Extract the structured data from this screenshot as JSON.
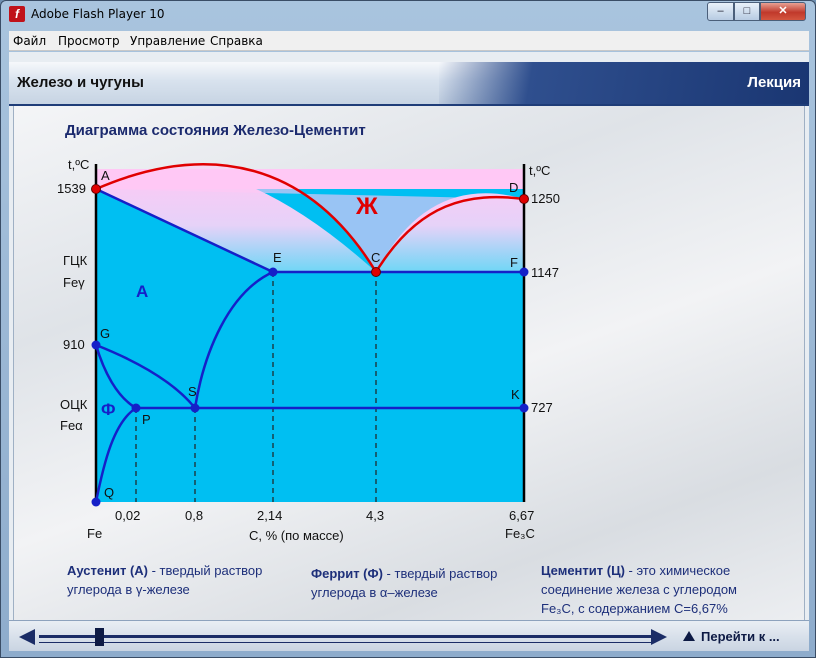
{
  "window": {
    "title": "Adobe Flash Player 10",
    "app_icon": "flash-icon"
  },
  "menu": [
    "Файл",
    "Просмотр",
    "Управление",
    "Справка"
  ],
  "header": {
    "title": "Железо и чугуны",
    "right": "Лекция"
  },
  "diagram": {
    "title": "Диаграмма состояния Железо-Цементит",
    "y_label_left": "t,ºC",
    "y_label_right": "t,ºC",
    "y_left_ticks": [
      "1539",
      "910"
    ],
    "y_right_ticks": [
      "1250",
      "1147",
      "727"
    ],
    "phase_left_gcc": [
      "ГЦК",
      "Feγ"
    ],
    "phase_left_bcc": [
      "ОЦК",
      "Feα"
    ],
    "region_liquid": "Ж",
    "region_austenite": "А",
    "region_ferrite": "Ф",
    "points": [
      "A",
      "D",
      "E",
      "C",
      "F",
      "G",
      "S",
      "K",
      "P",
      "Q"
    ],
    "x_ticks": [
      "0,02",
      "0,8",
      "2,14",
      "4,3",
      "6,67"
    ],
    "x_left_label": "Fe",
    "x_right_label": "Fe₃C",
    "x_axis_label": "С, % (по массе)"
  },
  "chart_data": {
    "type": "phase-diagram",
    "title": "Диаграмма состояния Железо-Цементит",
    "xlabel": "С, % (по массе)",
    "ylabel": "t,ºC",
    "points": [
      {
        "name": "A",
        "c": 0,
        "t": 1539
      },
      {
        "name": "D",
        "c": 6.67,
        "t": 1250
      },
      {
        "name": "E",
        "c": 2.14,
        "t": 1147
      },
      {
        "name": "C",
        "c": 4.3,
        "t": 1147
      },
      {
        "name": "F",
        "c": 6.67,
        "t": 1147
      },
      {
        "name": "G",
        "c": 0,
        "t": 910
      },
      {
        "name": "S",
        "c": 0.8,
        "t": 727
      },
      {
        "name": "P",
        "c": 0.02,
        "t": 727
      },
      {
        "name": "K",
        "c": 6.67,
        "t": 727
      },
      {
        "name": "Q",
        "c": 0
      }
    ],
    "colors": {
      "liquid": "#ffc8f5",
      "solid": "#00bff2",
      "liquidus": "#e00000",
      "lines": "#1520c8"
    }
  },
  "definitions": {
    "austenite": {
      "term": "Аустенит (А)",
      "text1": " - твердый раствор",
      "text2": "углерода в γ-железе"
    },
    "ferrite": {
      "term": "Феррит (Ф)",
      "text1": " - твердый раствор",
      "text2": "углерода в α–железе"
    },
    "cementite": {
      "term": "Цементит (Ц)",
      "text1": " - это химическое",
      "text2": "соединение железа с углеродом",
      "text3": "Fe₃C, с содержанием С=6,67%"
    }
  },
  "nav": {
    "goto": "Перейти к ..."
  }
}
